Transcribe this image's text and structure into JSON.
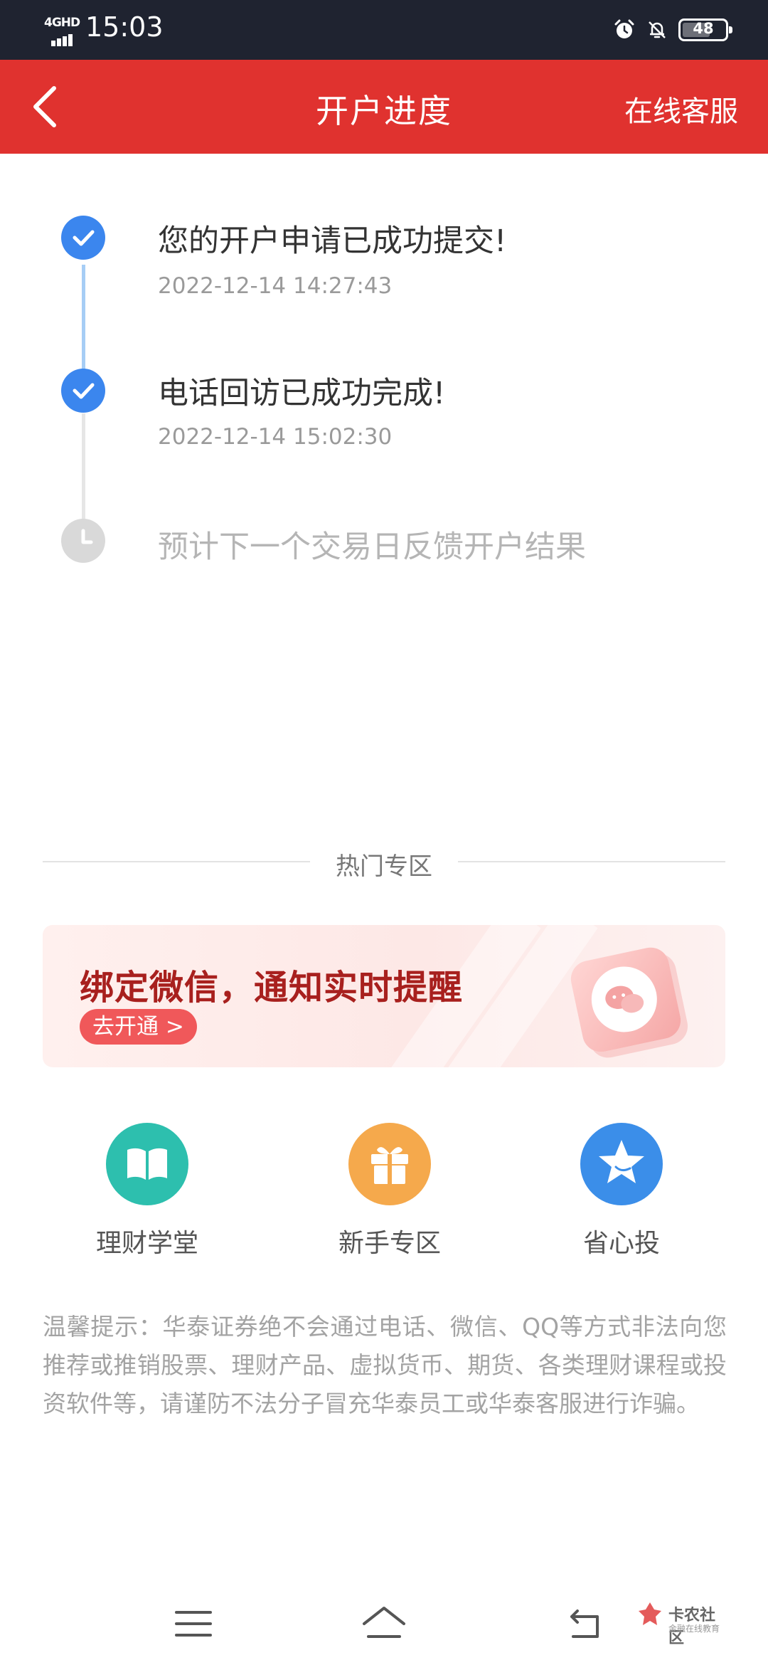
{
  "status_bar": {
    "network_label": "4GHD",
    "time": "15:03",
    "battery_level": "48"
  },
  "header": {
    "title": "开户进度",
    "right_link": "在线客服",
    "back_icon": "chevron-left-icon"
  },
  "timeline": [
    {
      "status": "done",
      "title": "您的开户申请已成功提交!",
      "time": "2022-12-14 14:27:43"
    },
    {
      "status": "done",
      "title": "电话回访已成功完成!",
      "time": "2022-12-14 15:02:30"
    },
    {
      "status": "pending",
      "title": "预计下一个交易日反馈开户结果"
    }
  ],
  "hot_section": {
    "label": "热门专区"
  },
  "banner": {
    "title": "绑定微信，通知实时提醒",
    "button_label": "去开通 >",
    "icon": "wechat-icon"
  },
  "quick_entries": [
    {
      "label": "理财学堂",
      "icon": "book-icon",
      "color": "#2dbfae"
    },
    {
      "label": "新手专区",
      "icon": "gift-icon",
      "color": "#f5a94c"
    },
    {
      "label": "省心投",
      "icon": "star-icon",
      "color": "#3b8ee9"
    }
  ],
  "tip": {
    "text": "温馨提示：华泰证券绝不会通过电话、微信、QQ等方式非法向您推荐或推销股票、理财产品、虚拟货币、期货、各类理财课程或投资软件等，请谨防不法分子冒充华泰员工或华泰客服进行诈骗。"
  },
  "watermark": {
    "text": "卡农社区",
    "sub": "金融在线教育"
  },
  "colors": {
    "header_red": "#e0322f",
    "status_bar": "#1f2330",
    "timeline_blue": "#3b86ee",
    "banner_title": "#a8201e"
  }
}
